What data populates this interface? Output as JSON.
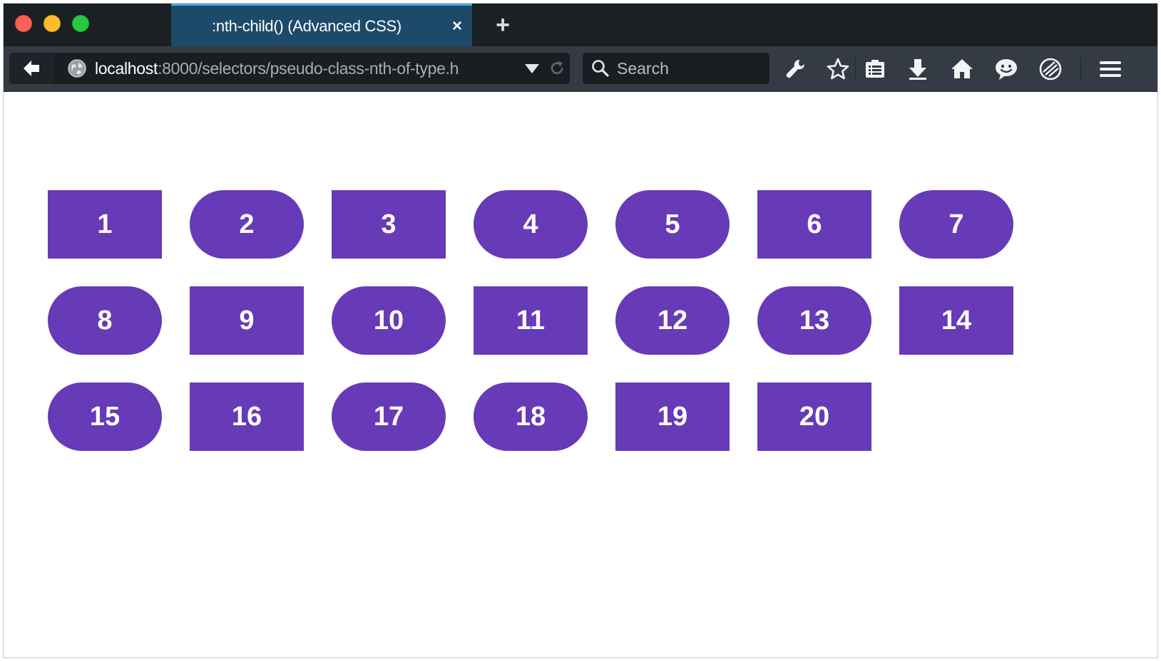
{
  "window": {
    "traffic_lights": [
      "close",
      "minimize",
      "maximize"
    ],
    "colors": {
      "close": "#fc5f57",
      "minimize": "#fdbc2e",
      "maximize": "#28c840"
    }
  },
  "tab": {
    "title": ":nth-child() (Advanced CSS)",
    "close_label": "×",
    "new_tab_label": "+"
  },
  "navbar": {
    "url_host": "localhost",
    "url_rest": ":8000/selectors/pseudo-class-nth-of-type.h",
    "search_placeholder": "Search",
    "icons": [
      "back-arrow-icon",
      "globe-icon",
      "dropdown-arrow-icon",
      "reload-icon",
      "search-icon",
      "wrench-icon",
      "star-icon",
      "reading-list-icon",
      "download-icon",
      "home-icon",
      "chat-icon",
      "pocket-icon",
      "hamburger-menu-icon"
    ]
  },
  "content": {
    "accent_color": "#673ab7",
    "boxes": [
      {
        "label": "1",
        "shape": "square"
      },
      {
        "label": "2",
        "shape": "pill"
      },
      {
        "label": "3",
        "shape": "square"
      },
      {
        "label": "4",
        "shape": "pill"
      },
      {
        "label": "5",
        "shape": "pill"
      },
      {
        "label": "6",
        "shape": "square"
      },
      {
        "label": "7",
        "shape": "pill"
      },
      {
        "label": "8",
        "shape": "pill"
      },
      {
        "label": "9",
        "shape": "square"
      },
      {
        "label": "10",
        "shape": "pill"
      },
      {
        "label": "11",
        "shape": "square"
      },
      {
        "label": "12",
        "shape": "pill"
      },
      {
        "label": "13",
        "shape": "pill"
      },
      {
        "label": "14",
        "shape": "square"
      },
      {
        "label": "15",
        "shape": "pill"
      },
      {
        "label": "16",
        "shape": "square"
      },
      {
        "label": "17",
        "shape": "pill"
      },
      {
        "label": "18",
        "shape": "pill"
      },
      {
        "label": "19",
        "shape": "square"
      },
      {
        "label": "20",
        "shape": "square"
      }
    ]
  }
}
